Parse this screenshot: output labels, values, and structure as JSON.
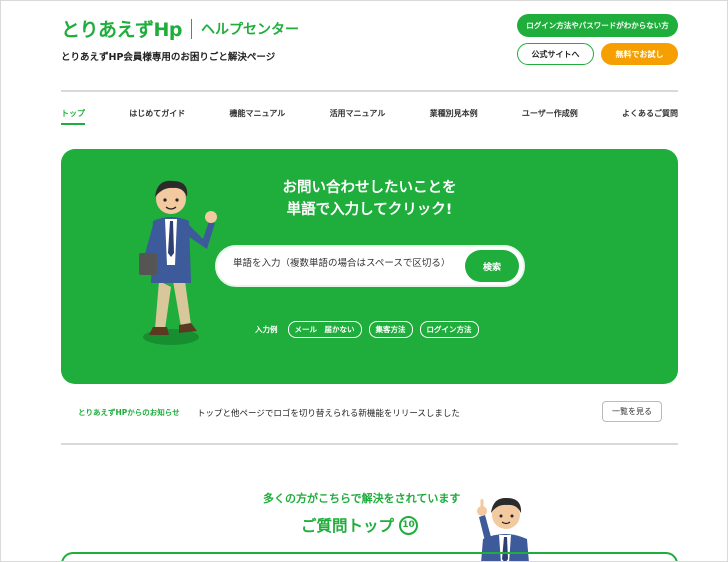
{
  "header": {
    "logo_brand": "とりあえずHp",
    "logo_sub": "ヘルプセンター",
    "tagline": "とりあえずHP会員様専用のお困りごと解決ページ",
    "login_help_label": "ログイン方法やパスワードがわからない方",
    "official_site_label": "公式サイトへ",
    "free_trial_label": "無料でお試し"
  },
  "nav": {
    "items": [
      "トップ",
      "はじめてガイド",
      "機能マニュアル",
      "活用マニュアル",
      "業種別見本例",
      "ユーザー作成例",
      "よくあるご質問"
    ]
  },
  "hero": {
    "title_line1": "お問い合わせしたいことを",
    "title_line2": "単語で入力してクリック!",
    "search_placeholder": "単語を入力（複数単語の場合はスペースで区切る）",
    "search_button": "検索",
    "examples_label": "入力例",
    "examples": [
      "メール　届かない",
      "集客方法",
      "ログイン方法"
    ]
  },
  "news": {
    "label": "とりあえずHPからのお知らせ",
    "text": "トップと他ページでロゴを切り替えられる新機能をリリースしました",
    "list_button": "一覧を見る"
  },
  "faq": {
    "subtitle": "多くの方がこちらで解決をされています",
    "title": "ご質問トップ",
    "badge": "10"
  },
  "colors": {
    "brand_green": "#1fad3c",
    "accent_orange": "#f5a000"
  }
}
